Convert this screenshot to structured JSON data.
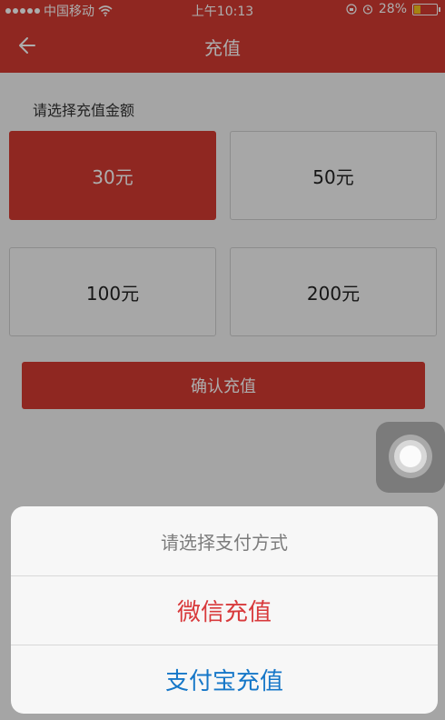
{
  "status_bar": {
    "carrier": "中国移动",
    "time": "上午10:13",
    "battery_pct": "28%",
    "battery_level": 0.28
  },
  "nav": {
    "title": "充值",
    "back_icon": "back-arrow-icon"
  },
  "content": {
    "prompt": "请选择充值金额",
    "amounts": [
      {
        "label": "30元",
        "selected": true
      },
      {
        "label": "50元",
        "selected": false
      },
      {
        "label": "100元",
        "selected": false
      },
      {
        "label": "200元",
        "selected": false
      }
    ],
    "confirm_label": "确认充值"
  },
  "sheet": {
    "title": "请选择支付方式",
    "options": [
      {
        "label": "微信充值",
        "color": "#d8393b"
      },
      {
        "label": "支付宝充值",
        "color": "#1677c8"
      }
    ]
  },
  "colors": {
    "brand_red": "#d33a31",
    "wechat_red": "#d8393b",
    "alipay_blue": "#1677c8",
    "battery_yellow": "#f4c11b"
  }
}
